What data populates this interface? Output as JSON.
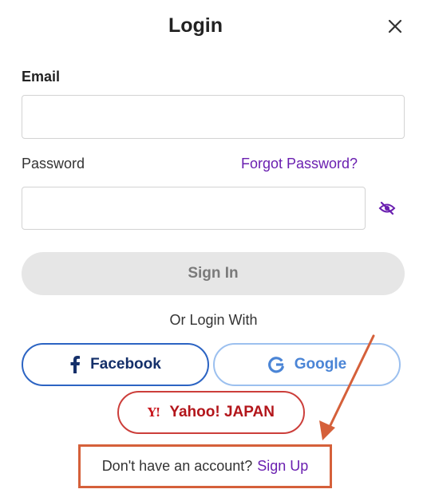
{
  "dialog": {
    "title": "Login"
  },
  "form": {
    "email_label": "Email",
    "email_value": "",
    "password_label": "Password",
    "password_value": "",
    "forgot_password": "Forgot Password?",
    "sign_in": "Sign In"
  },
  "social": {
    "divider": "Or Login With",
    "facebook": "Facebook",
    "google": "Google",
    "yahoo_mark": "Y!",
    "yahoo": "Yahoo! JAPAN"
  },
  "signup": {
    "prompt": "Don't have an account?",
    "link": "Sign Up"
  },
  "icons": {
    "close": "close-icon",
    "password_visibility": "eye-off-icon",
    "facebook": "facebook-icon",
    "google": "google-icon",
    "yahoo": "yahoo-icon"
  },
  "colors": {
    "link": "#6a1fb0",
    "facebook_border": "#2c64c3",
    "google_border": "#9cc0ef",
    "yahoo_border": "#cc3e3a",
    "annotation": "#d5603a",
    "sign_in_bg": "#e6e6e6"
  }
}
